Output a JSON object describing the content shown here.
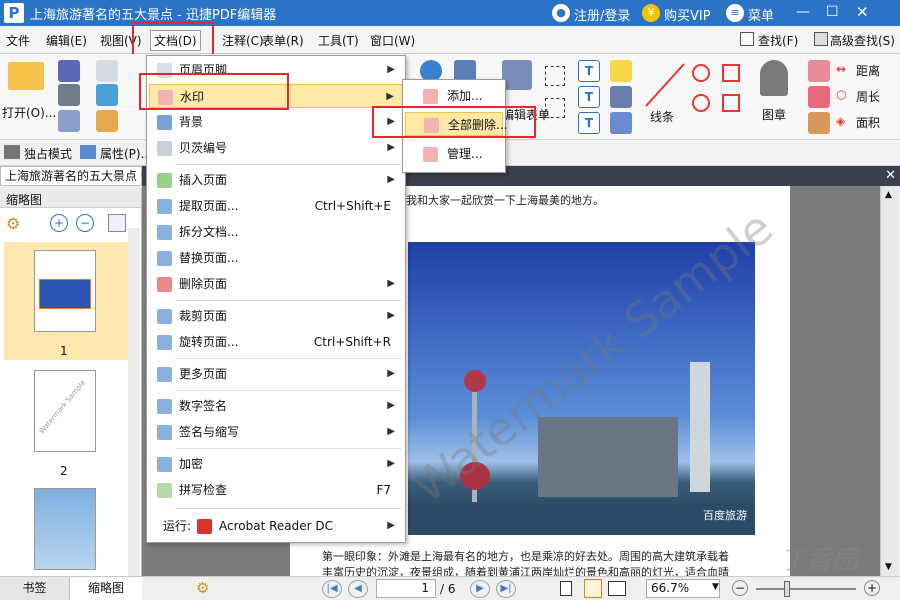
{
  "titlebar": {
    "app_icon": "P",
    "title": "上海旅游著名的五大景点 - 迅捷PDF编辑器",
    "login": "注册/登录",
    "buy": "购买VIP",
    "menu": "菜单",
    "buy_icon": "¥"
  },
  "menubar": {
    "items": [
      "文件",
      "编辑(E)",
      "视图(V)",
      "文档(D)",
      "注释(C)",
      "表单(R)",
      "工具(T)",
      "窗口(W)"
    ],
    "find": "查找(F)",
    "adv_find": "高级查找(S)"
  },
  "ribbon": {
    "open": "打开(O)...",
    "line": "线条",
    "stamp": "图章",
    "distance": "距离",
    "perimeter": "周长",
    "area": "面积",
    "form_table": "编辑表单"
  },
  "row2": {
    "mode": "独占模式",
    "props": "属性(P)..."
  },
  "doc_tab": "上海旅游著名的五大景点 *",
  "left_panel": {
    "title": "缩略图",
    "page1": "1",
    "page2": "2",
    "mini_wm": "Watermark Sample"
  },
  "page": {
    "top_text": "我和大家一起欣赏一下上海最美的地方。",
    "body_1": "第一眼印象：外滩是上海最有名的地方，也是乘凉的好去处。周围的高大建筑承载着",
    "body_2": "丰富历史的沉淀，夜景组成，随着到黄浦江两岸灿烂的景色和高丽的灯光，适合血晴",
    "photo_logo": "百度旅游",
    "watermark": "Watermark Sample",
    "site_wm": "丁香园"
  },
  "doc_menu": [
    {
      "label": "页眉页脚"
    },
    {
      "label": "水印"
    },
    {
      "label": "背景"
    },
    {
      "label": "贝茨编号"
    },
    {
      "label": "插入页面"
    },
    {
      "label": "提取页面...",
      "shortcut": "Ctrl+Shift+E"
    },
    {
      "label": "拆分文档..."
    },
    {
      "label": "替换页面..."
    },
    {
      "label": "删除页面"
    },
    {
      "label": "裁剪页面"
    },
    {
      "label": "旋转页面...",
      "shortcut": "Ctrl+Shift+R"
    },
    {
      "label": "更多页面"
    },
    {
      "label": "数字签名"
    },
    {
      "label": "签名与缩写"
    },
    {
      "label": "加密"
    },
    {
      "label": "拼写检查",
      "shortcut": "F7"
    },
    {
      "label": "运行:",
      "app": "Acrobat Reader DC"
    }
  ],
  "watermark_submenu": [
    "添加...",
    "全部删除...",
    "管理..."
  ],
  "status": {
    "page_current": "1",
    "page_total": "/ 6",
    "zoom": "66.7%",
    "tab_bookmark": "书签",
    "tab_thumbnail": "缩略图"
  },
  "colors": {
    "titlebar": "#2b73c6",
    "highlight": "#ffe9a6",
    "red_box": "#e8262d"
  }
}
